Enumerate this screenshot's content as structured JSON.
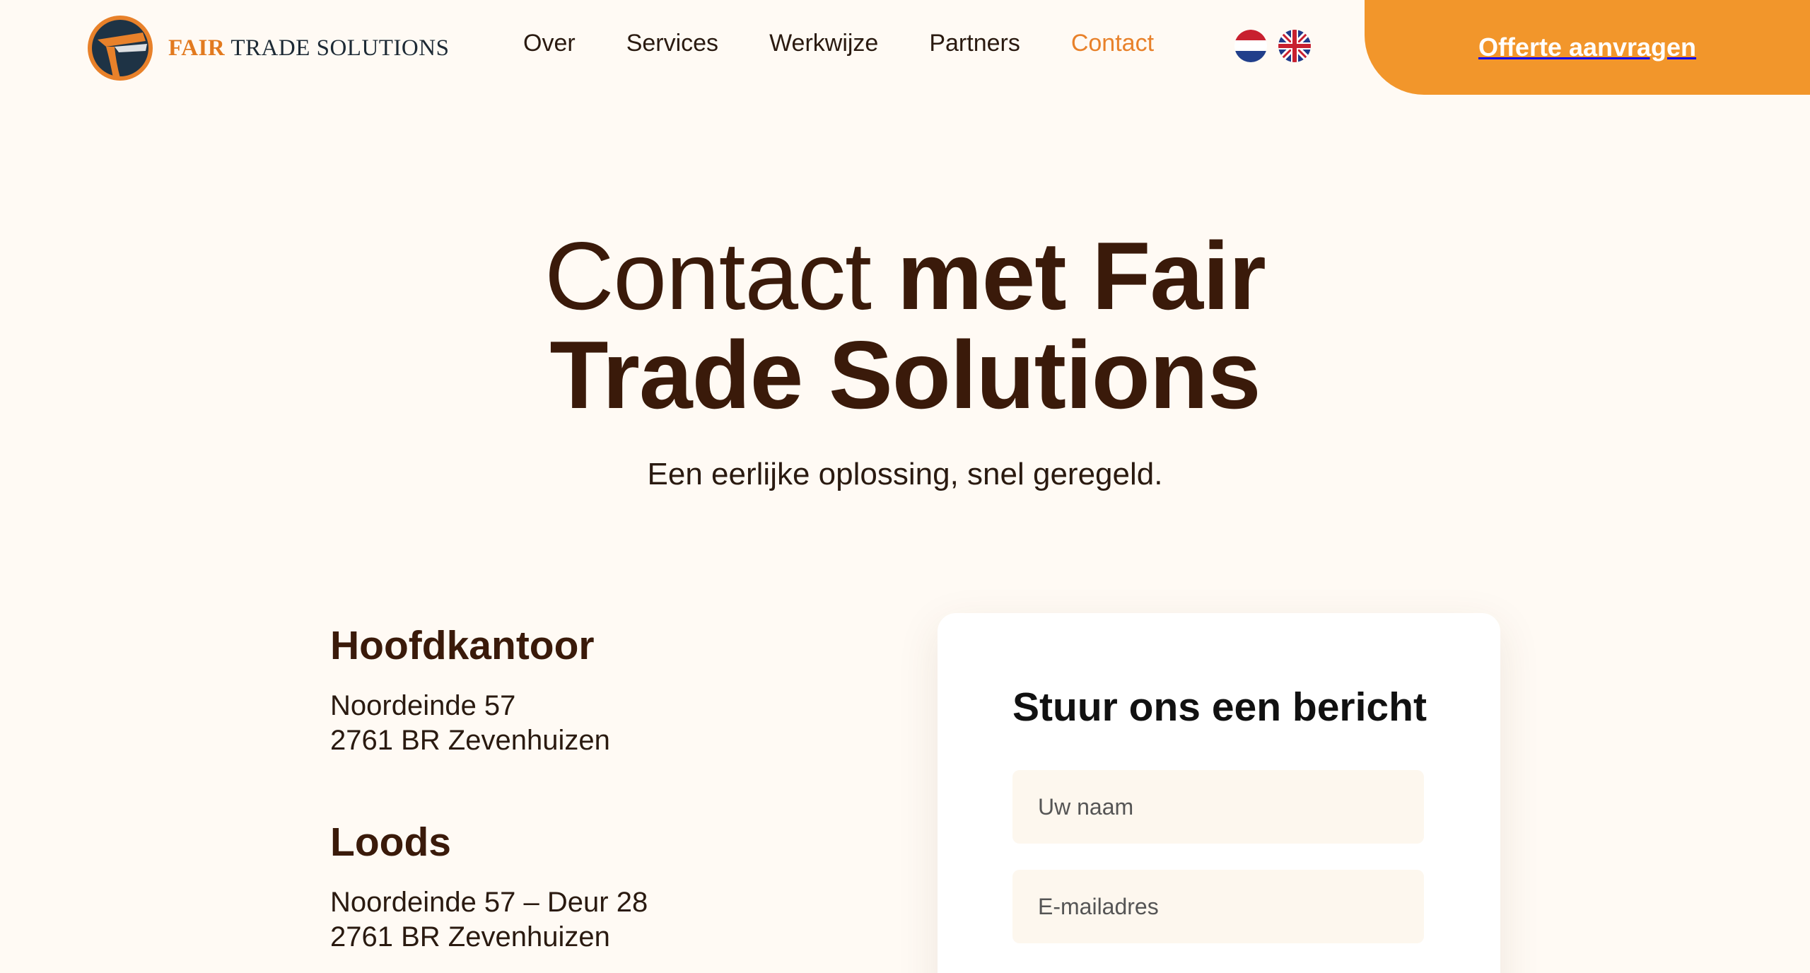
{
  "brand": {
    "name_accent": "FAIR",
    "name_rest": "TRADE SOLUTIONS",
    "colors": {
      "accent": "#f2962b",
      "text": "#3a1a0a",
      "background": "#fffaf4"
    }
  },
  "nav": {
    "items": [
      {
        "label": "Over"
      },
      {
        "label": "Services"
      },
      {
        "label": "Werkwijze"
      },
      {
        "label": "Partners"
      },
      {
        "label": "Contact",
        "active": true
      }
    ]
  },
  "languages": [
    {
      "icon": "netherlands-flag-icon"
    },
    {
      "icon": "uk-flag-icon"
    }
  ],
  "cta": {
    "label": "Offerte aanvragen"
  },
  "hero": {
    "title_light": "Contact",
    "title_bold_1": "met Fair",
    "title_bold_2": "Trade Solutions",
    "subtitle": "Een eerlijke oplossing, snel geregeld."
  },
  "offices": [
    {
      "title": "Hoofdkantoor",
      "line1": "Noordeinde 57",
      "line2": "2761 BR Zevenhuizen"
    },
    {
      "title": "Loods",
      "line1": "Noordeinde 57 – Deur 28",
      "line2": "2761 BR Zevenhuizen"
    }
  ],
  "form": {
    "title": "Stuur ons een bericht",
    "name_placeholder": "Uw naam",
    "email_placeholder": "E-mailadres"
  }
}
